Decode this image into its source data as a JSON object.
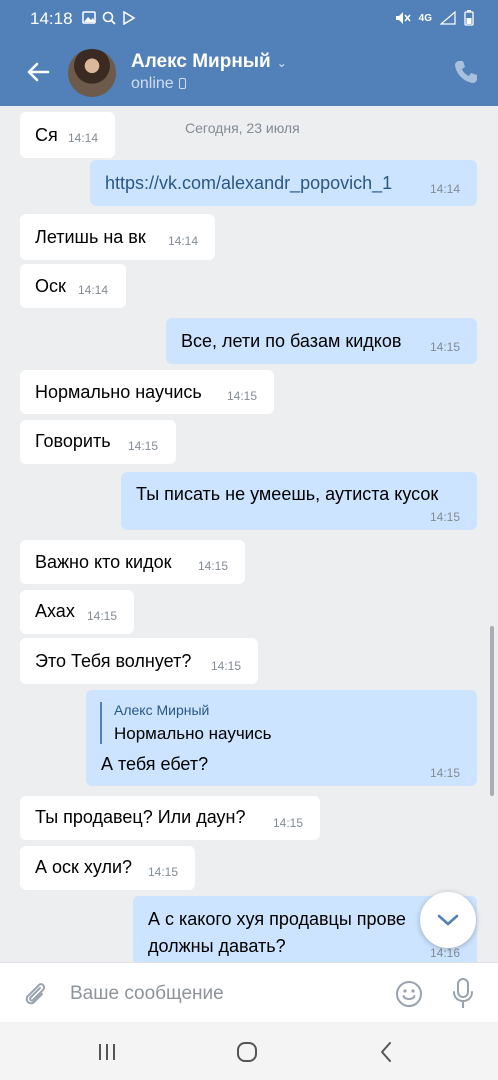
{
  "statusbar": {
    "time": "14:18",
    "network": "4G"
  },
  "header": {
    "name": "Алекс Мирный",
    "status": "online"
  },
  "date_separator": "Сегодня, 23 июля",
  "messages": [
    {
      "dir": "in",
      "text": "Ся",
      "time": "14:14"
    },
    {
      "dir": "out",
      "text": "https://vk.com/alexandr_popovich_1",
      "time": "14:14"
    },
    {
      "dir": "in",
      "text": "Летишь на вк",
      "time": "14:14"
    },
    {
      "dir": "in",
      "text": "Оск",
      "time": "14:14"
    },
    {
      "dir": "out",
      "text": "Все, лети по базам кидков",
      "time": "14:15"
    },
    {
      "dir": "in",
      "text": "Нормально научись",
      "time": "14:15"
    },
    {
      "dir": "in",
      "text": "Говорить",
      "time": "14:15"
    },
    {
      "dir": "out",
      "text": "Ты писать не умеешь, аутиста кусок",
      "time": "14:15"
    },
    {
      "dir": "in",
      "text": "Важно кто кидок",
      "time": "14:15"
    },
    {
      "dir": "in",
      "text": "Ахах",
      "time": "14:15"
    },
    {
      "dir": "in",
      "text": "Это Тебя волнует?",
      "time": "14:15"
    },
    {
      "dir": "out",
      "reply_author": "Алекс Мирный",
      "reply_text": "Нормально научись",
      "text": "А тебя ебет?",
      "time": "14:15"
    },
    {
      "dir": "in",
      "text": "Ты продавец?  Или даун?",
      "time": "14:15"
    },
    {
      "dir": "in",
      "text": "А оск хули?",
      "time": "14:15"
    },
    {
      "dir": "out",
      "text_line1": "А с какого хуя продавцы прове",
      "text_line2": "должны давать?",
      "time": "14:16"
    }
  ],
  "composer": {
    "placeholder": "Ваше сообщение"
  },
  "colors": {
    "header": "#5181b8",
    "outgoing": "#cce4ff",
    "incoming": "#ffffff",
    "background": "#edeef0"
  },
  "icons": [
    "back-arrow-icon",
    "phone-icon",
    "paperclip-icon",
    "smile-icon",
    "microphone-icon",
    "chevron-down-icon",
    "recent-apps-icon",
    "home-icon",
    "back-nav-icon"
  ]
}
